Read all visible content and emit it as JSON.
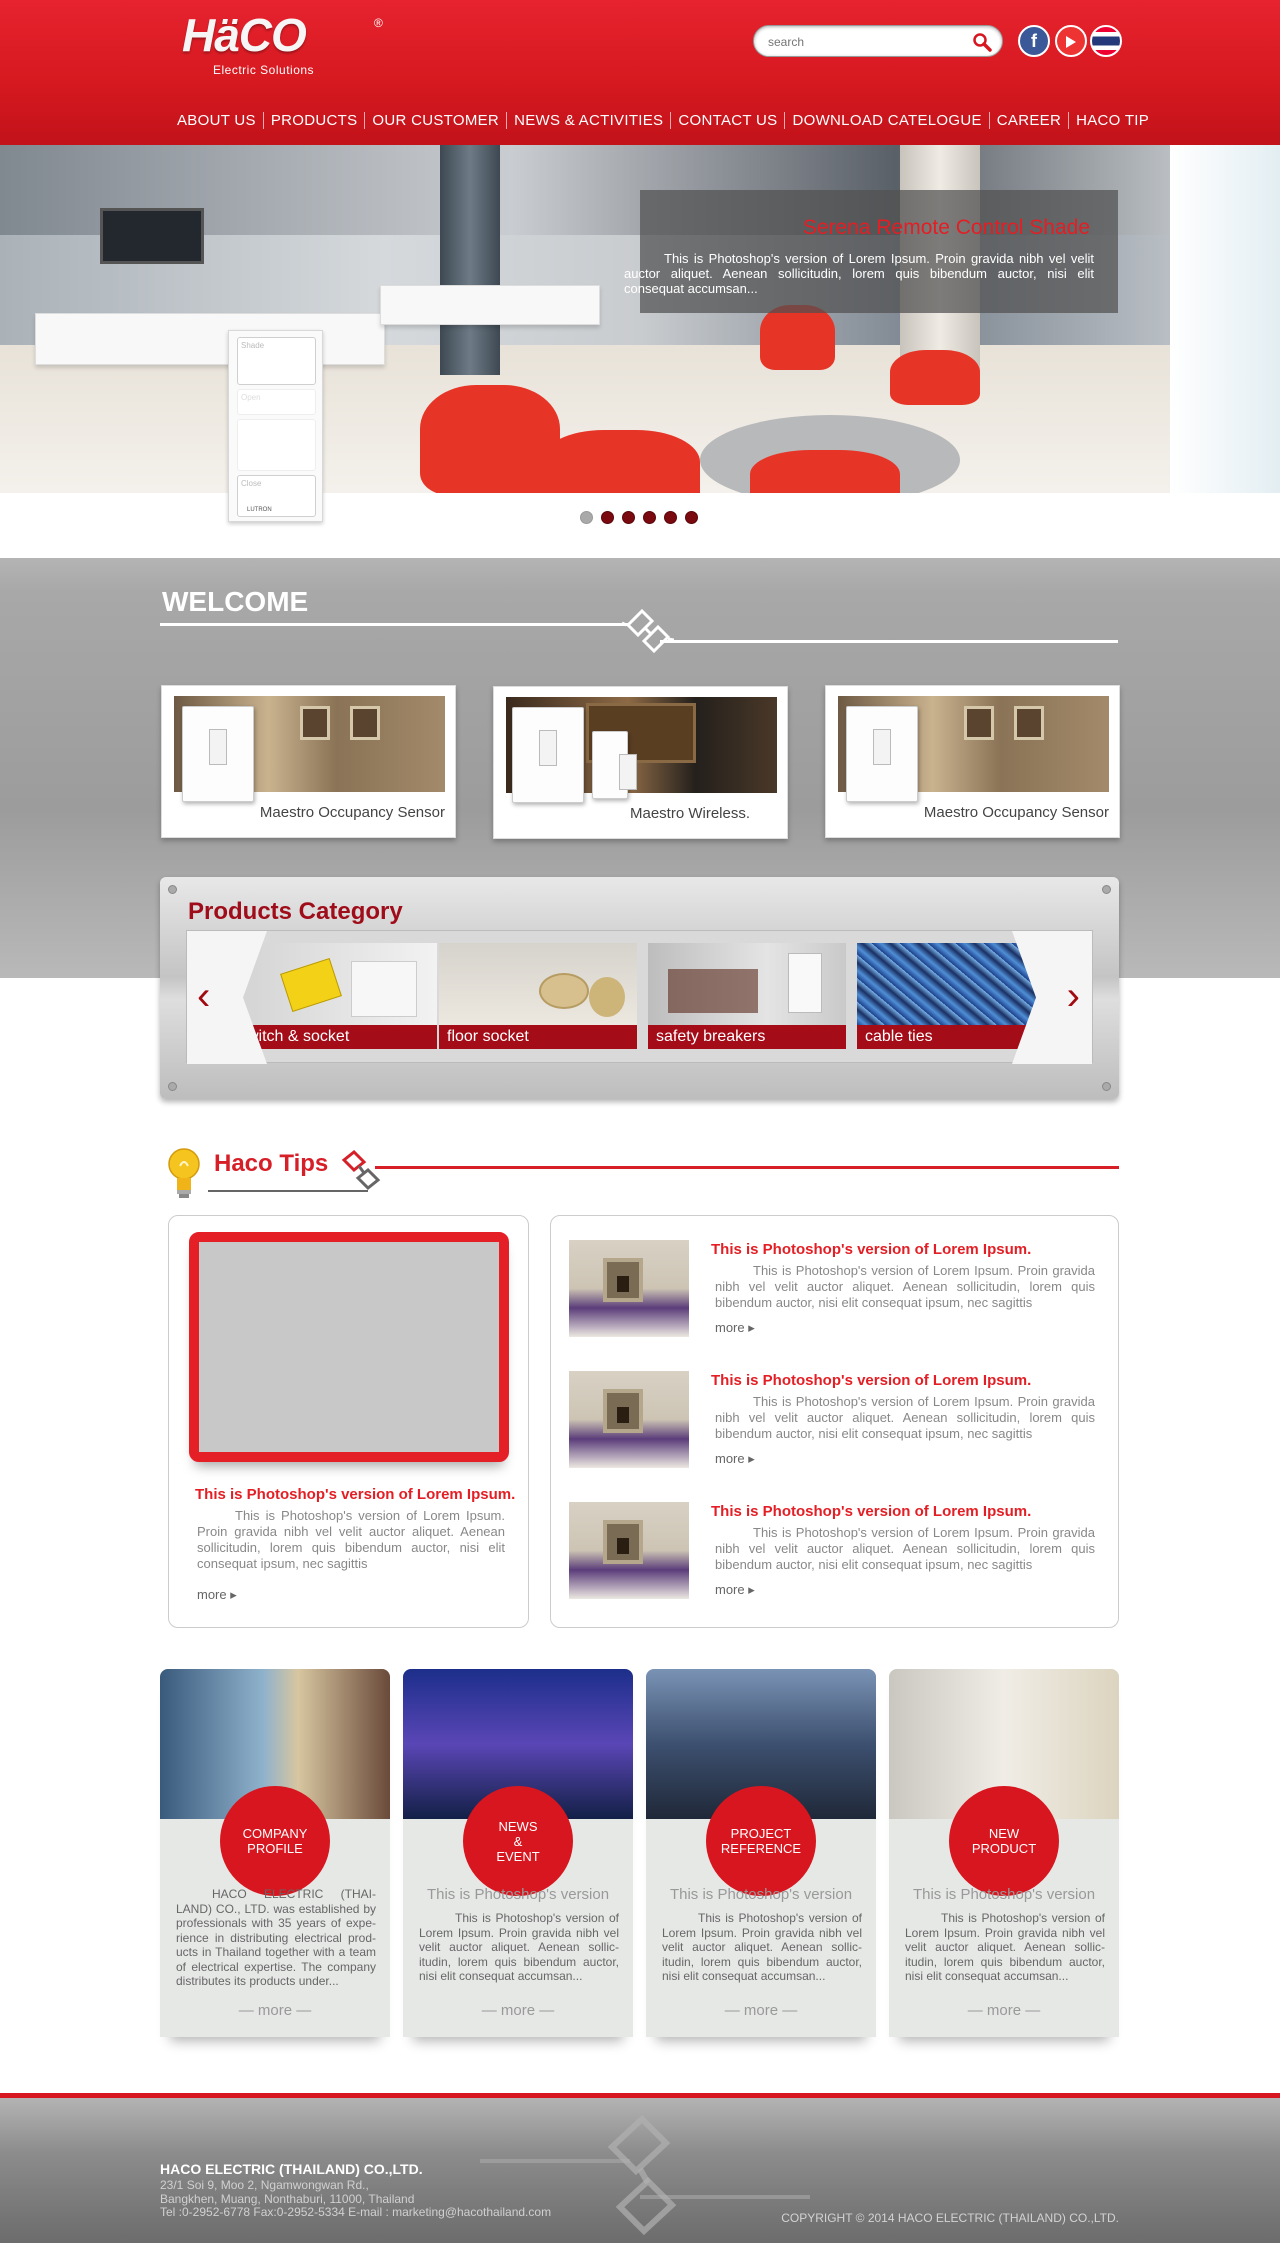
{
  "brand": {
    "name": "HäCO",
    "reg": "®",
    "tagline": "Electric Solutions"
  },
  "header": {
    "search_placeholder": "search",
    "social": {
      "facebook": "f"
    }
  },
  "nav": [
    "ABOUT  US",
    "PRODUCTS",
    "OUR  CUSTOMER",
    "NEWS  &  ACTIVITIES",
    "CONTACT  US",
    "DOWNLOAD  CATELOGUE",
    "CAREER",
    "HACO  TIP"
  ],
  "slider": {
    "title": "Serena Remote Control Shade",
    "text": "This is Photoshop's version  of Lorem Ipsum. Proin gravida nibh vel velit auctor aliquet. Aenean sollicitudin, lorem quis bibendum auctor, nisi elit consequat accumsan...",
    "remote_buttons": [
      "Shade",
      "Open",
      "Close"
    ],
    "remote_brand": "LUTRON",
    "dot_count": 6,
    "active_dot": 0
  },
  "welcome": {
    "title": "WELCOME",
    "cards": [
      "Maestro Occupancy Sensor",
      "Maestro Wireless.",
      "Maestro Occupancy Sensor"
    ]
  },
  "products_category": {
    "title": "Products Category",
    "items": [
      "witch & socket",
      "floor socket",
      "safety breakers",
      "cable ties"
    ],
    "prev": "‹",
    "next": "›"
  },
  "tips": {
    "title": "Haco Tips",
    "featured": {
      "title": "This is Photoshop's version  of Lorem Ipsum.",
      "body": "This is Photoshop's version  of Lorem Ipsum. Proin gravida nibh vel velit auctor aliquet. Aenean sollicitudin, lorem quis bibendum auctor, nisi elit consequat ipsum, nec sagittis",
      "more": "more ▸"
    },
    "list": [
      {
        "title": "This is Photoshop's version  of Lorem Ipsum.",
        "body": "This is Photoshop's version  of Lorem Ipsum. Proin gravida nibh vel velit auctor aliquet. Aenean sollicitudin, lorem quis bibendum auctor, nisi elit consequat ipsum, nec sagittis",
        "more": "more ▸"
      },
      {
        "title": "This is Photoshop's version  of Lorem Ipsum.",
        "body": "This is Photoshop's version  of Lorem Ipsum. Proin gravida nibh vel velit auctor aliquet. Aenean sollicitudin, lorem quis bibendum auctor, nisi elit consequat ipsum, nec sagittis",
        "more": "more ▸"
      },
      {
        "title": "This is Photoshop's version  of Lorem Ipsum.",
        "body": "This is Photoshop's version  of Lorem Ipsum. Proin gravida nibh vel velit auctor aliquet. Aenean sollicitudin, lorem quis bibendum auctor, nisi elit consequat ipsum, nec sagittis",
        "more": "more ▸"
      }
    ]
  },
  "features": [
    {
      "label": "COMPANY\nPROFILE",
      "title": "",
      "body": "HACO ELECTRIC (THAI-LAND) CO., LTD. was established by professionals with 35 years of expe-rience in distributing electrical prod-ucts in Thailand together with a team of electrical expertise. The company distributes its products under...",
      "more": "— more —"
    },
    {
      "label": "NEWS\n&\nEVENT",
      "title": "This is Photoshop's version",
      "body": "This is Photoshop's version of Lorem Ipsum. Proin gravida nibh vel velit auctor aliquet. Aenean sollic-itudin, lorem quis bibendum auctor, nisi elit consequat accumsan...",
      "more": "— more —"
    },
    {
      "label": "PROJECT\nREFERENCE",
      "title": "This is Photoshop's version",
      "body": "This is Photoshop's version of Lorem Ipsum. Proin gravida nibh vel velit auctor aliquet. Aenean sollic-itudin, lorem quis bibendum auctor, nisi elit consequat accumsan...",
      "more": "— more —"
    },
    {
      "label": "NEW\nPRODUCT",
      "title": "This is Photoshop's version",
      "body": "This is Photoshop's version of Lorem Ipsum. Proin gravida nibh vel velit auctor aliquet. Aenean sollic-itudin, lorem quis bibendum auctor, nisi elit consequat accumsan...",
      "more": "— more —"
    }
  ],
  "footer": {
    "company": "HACO ELECTRIC (THAILAND) CO.,LTD.",
    "address1": "23/1 Soi 9, Moo 2, Ngamwongwan Rd.,",
    "address2": "Bangkhen, Muang, Nonthaburi, 11000, Thailand",
    "contact": "Tel :0-2952-6778 Fax:0-2952-5334 E-mail : marketing@hacothailand.com",
    "copyright": "COPYRIGHT © 2014 HACO ELECTRIC (THAILAND) CO.,LTD."
  },
  "colors": {
    "brand_red": "#d8161f",
    "dark_red": "#a40c18",
    "grey_band": "#a8a8a8"
  }
}
